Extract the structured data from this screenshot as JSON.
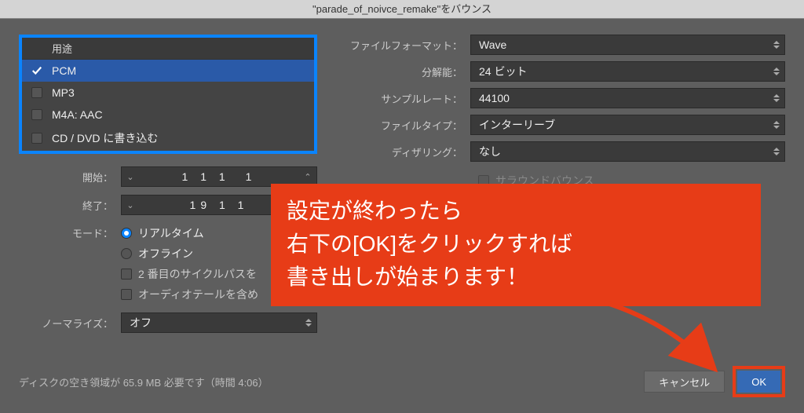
{
  "title": "\"parade_of_noivce_remake\"をバウンス",
  "purpose": {
    "header": "用途",
    "items": [
      {
        "label": "PCM",
        "checked": true,
        "selected": true
      },
      {
        "label": "MP3",
        "checked": false,
        "selected": false
      },
      {
        "label": "M4A: AAC",
        "checked": false,
        "selected": false
      },
      {
        "label": "CD / DVD に書き込む",
        "checked": false,
        "selected": false
      }
    ]
  },
  "left": {
    "start_label": "開始：",
    "start_value": "1 1 1　1",
    "end_label": "終了：",
    "end_value": "19 1 1",
    "mode_label": "モード：",
    "mode_options": [
      {
        "label": "リアルタイム",
        "on": true
      },
      {
        "label": "オフライン",
        "on": false
      }
    ],
    "cycle2_label": "2 番目のサイクルパスを",
    "audiotail_label": "オーディオテールを含め",
    "normalize_label": "ノーマライズ：",
    "normalize_value": "オフ"
  },
  "right": {
    "format_label": "ファイルフォーマット：",
    "format_value": "Wave",
    "resolution_label": "分解能：",
    "resolution_value": "24 ビット",
    "samplerate_label": "サンプルレート：",
    "samplerate_value": "44100",
    "filetype_label": "ファイルタイプ：",
    "filetype_value": "インターリーブ",
    "dither_label": "ディザリング：",
    "dither_value": "なし",
    "surround_label": "サラウンドバウンス"
  },
  "callout": {
    "line1": "設定が終わったら",
    "line2": "右下の[OK]をクリックすれば",
    "line3": "書き出しが始まります！"
  },
  "footer": {
    "disk_info": "ディスクの空き領域が 65.9 MB 必要です（時間 4:06）",
    "cancel": "キャンセル",
    "ok": "OK"
  }
}
